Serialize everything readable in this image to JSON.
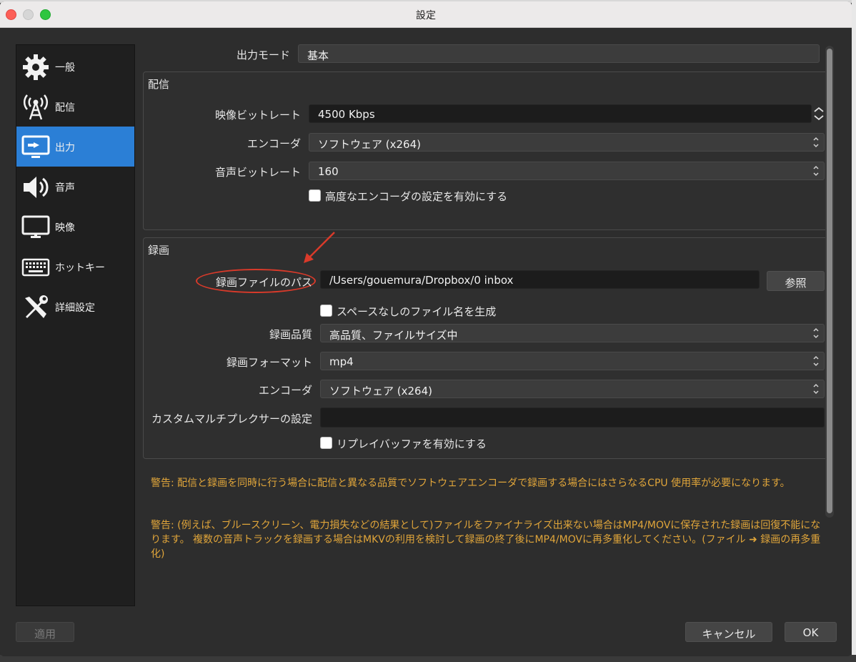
{
  "window": {
    "title": "設定"
  },
  "sidebar": {
    "items": [
      {
        "label": "一般"
      },
      {
        "label": "配信"
      },
      {
        "label": "出力"
      },
      {
        "label": "音声"
      },
      {
        "label": "映像"
      },
      {
        "label": "ホットキー"
      },
      {
        "label": "詳細設定"
      }
    ],
    "active_index": 2
  },
  "output_mode": {
    "label": "出力モード",
    "value": "基本"
  },
  "streaming": {
    "title": "配信",
    "video_bitrate": {
      "label": "映像ビットレート",
      "value": "4500 Kbps"
    },
    "encoder": {
      "label": "エンコーダ",
      "value": "ソフトウェア (x264)"
    },
    "audio_bitrate": {
      "label": "音声ビットレート",
      "value": "160"
    },
    "advanced_encoder": {
      "label": "高度なエンコーダの設定を有効にする",
      "checked": false
    }
  },
  "recording": {
    "title": "録画",
    "path": {
      "label": "録画ファイルのパス",
      "value": "/Users/gouemura/Dropbox/0 inbox"
    },
    "browse_label": "参照",
    "no_space": {
      "label": "スペースなしのファイル名を生成",
      "checked": false
    },
    "quality": {
      "label": "録画品質",
      "value": "高品質、ファイルサイズ中"
    },
    "format": {
      "label": "録画フォーマット",
      "value": "mp4"
    },
    "encoder": {
      "label": "エンコーダ",
      "value": "ソフトウェア (x264)"
    },
    "muxer": {
      "label": "カスタムマルチプレクサーの設定",
      "value": ""
    },
    "replay_buffer": {
      "label": "リプレイバッファを有効にする",
      "checked": false
    }
  },
  "warnings": [
    "警告: 配信と録画を同時に行う場合に配信と異なる品質でソフトウェアエンコーダで録画する場合にはさらなるCPU 使用率が必要になります。",
    "警告: (例えば、ブルースクリーン、電力損失などの結果として)ファイルをファイナライズ出来ない場合はMP4/MOVに保存された録画は回復不能になります。 複数の音声トラックを録画する場合はMKVの利用を検討して録画の終了後にMP4/MOVに再多重化してください。(ファイル ➜ 録画の再多重化)"
  ],
  "footer": {
    "apply_label": "適用",
    "cancel_label": "キャンセル",
    "ok_label": "OK"
  },
  "colors": {
    "accent": "#2b7fd6",
    "warning": "#e0a53a",
    "annotation": "#d93a2a"
  }
}
